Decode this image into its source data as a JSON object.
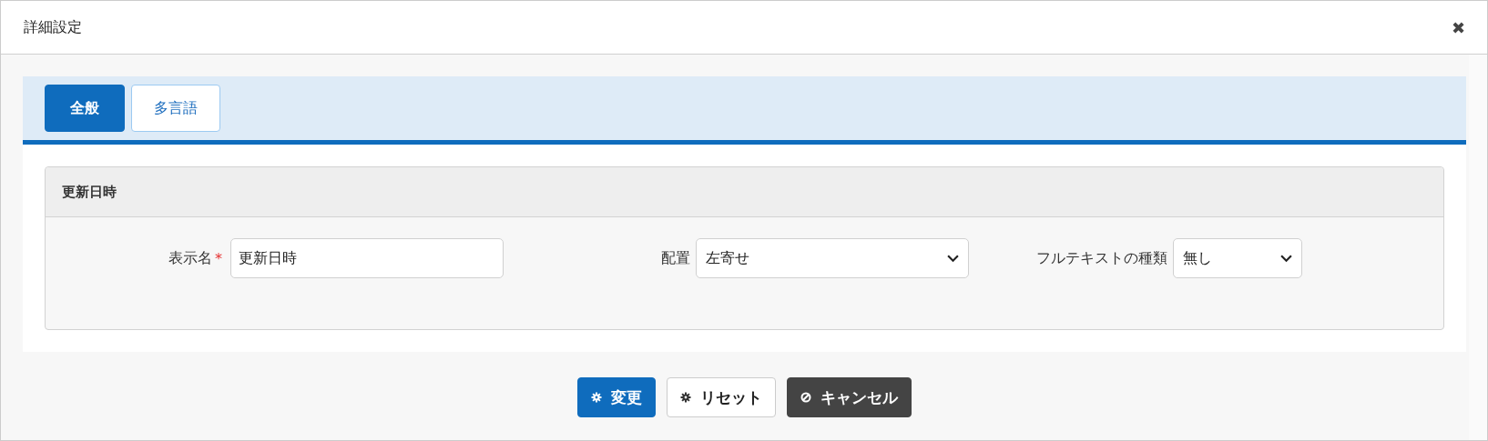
{
  "window": {
    "title": "詳細設定",
    "close": "✖"
  },
  "tabs": [
    {
      "label": "全般",
      "selected": true
    },
    {
      "label": "多言語",
      "selected": false
    }
  ],
  "section": {
    "title": "更新日時",
    "fields": [
      {
        "kind": "text",
        "label": "表示名",
        "required_mark": "*",
        "value": "更新日時"
      },
      {
        "kind": "select",
        "label": "配置",
        "value": "左寄せ"
      },
      {
        "kind": "select",
        "label": "フルテキストの種類",
        "value": "無し"
      }
    ]
  },
  "buttons": [
    {
      "label": "変更",
      "kind": "primary"
    },
    {
      "label": "リセット",
      "kind": "default"
    },
    {
      "label": "キャンセル",
      "kind": "dark"
    }
  ]
}
